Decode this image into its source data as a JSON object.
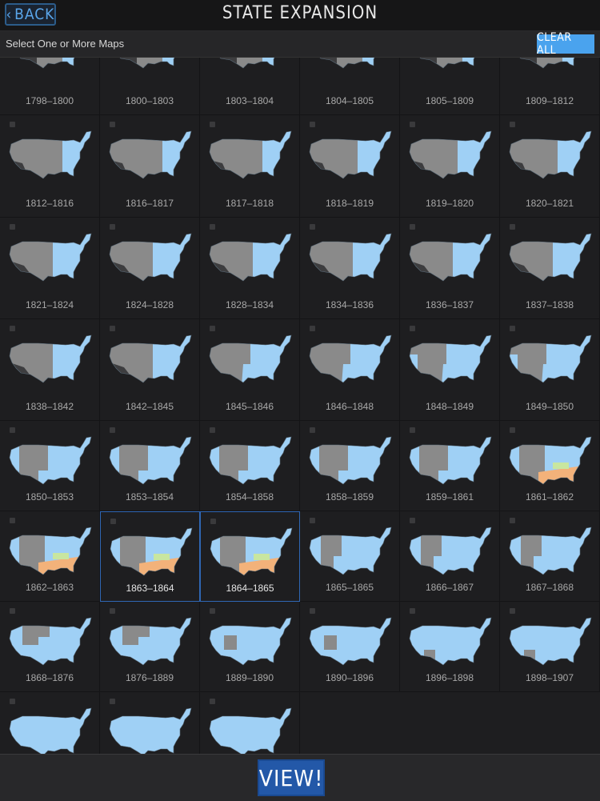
{
  "header": {
    "back_label": "BACK",
    "title": "STATE EXPANSION"
  },
  "subheader": {
    "hint": "Select One or More Maps",
    "clear_label": "CLEAR ALL"
  },
  "footer": {
    "view_label": "VIEW!"
  },
  "colors": {
    "state_blue": "#9fd0f5",
    "territory_gray": "#8a8a8a",
    "foreign_dark": "#3d3d3f",
    "confederate_orange": "#f3b27a",
    "border_green": "#c8e6a0",
    "selection_border": "#2f66b3",
    "accent": "#4aa3ee"
  },
  "maps": [
    {
      "label": "1798–1800",
      "stage": 0
    },
    {
      "label": "1800–1803",
      "stage": 0
    },
    {
      "label": "1803–1804",
      "stage": 0
    },
    {
      "label": "1804–1805",
      "stage": 0
    },
    {
      "label": "1805–1809",
      "stage": 0
    },
    {
      "label": "1809–1812",
      "stage": 0
    },
    {
      "label": "1812–1816",
      "stage": 1
    },
    {
      "label": "1816–1817",
      "stage": 1
    },
    {
      "label": "1817–1818",
      "stage": 1
    },
    {
      "label": "1818–1819",
      "stage": 2
    },
    {
      "label": "1819–1820",
      "stage": 2
    },
    {
      "label": "1820–1821",
      "stage": 2
    },
    {
      "label": "1821–1824",
      "stage": 3
    },
    {
      "label": "1824–1828",
      "stage": 3
    },
    {
      "label": "1828–1834",
      "stage": 3
    },
    {
      "label": "1834–1836",
      "stage": 3
    },
    {
      "label": "1836–1837",
      "stage": 3
    },
    {
      "label": "1837–1838",
      "stage": 3
    },
    {
      "label": "1838–1842",
      "stage": 3
    },
    {
      "label": "1842–1845",
      "stage": 3
    },
    {
      "label": "1845–1846",
      "stage": 4
    },
    {
      "label": "1846–1848",
      "stage": 4
    },
    {
      "label": "1848–1849",
      "stage": 5
    },
    {
      "label": "1849–1850",
      "stage": 5
    },
    {
      "label": "1850–1853",
      "stage": 6
    },
    {
      "label": "1853–1854",
      "stage": 6
    },
    {
      "label": "1854–1858",
      "stage": 6
    },
    {
      "label": "1858–1859",
      "stage": 6
    },
    {
      "label": "1859–1861",
      "stage": 6
    },
    {
      "label": "1861–1862",
      "stage": 7
    },
    {
      "label": "1862–1863",
      "stage": 7
    },
    {
      "label": "1863–1864",
      "stage": 7,
      "selected": true
    },
    {
      "label": "1864–1865",
      "stage": 7,
      "selected": true
    },
    {
      "label": "1865–1865",
      "stage": 8
    },
    {
      "label": "1866–1867",
      "stage": 8
    },
    {
      "label": "1867–1868",
      "stage": 8
    },
    {
      "label": "1868–1876",
      "stage": 9
    },
    {
      "label": "1876–1889",
      "stage": 9
    },
    {
      "label": "1889–1890",
      "stage": 10
    },
    {
      "label": "1890–1896",
      "stage": 10
    },
    {
      "label": "1896–1898",
      "stage": 11
    },
    {
      "label": "1898–1907",
      "stage": 11
    },
    {
      "label": "",
      "stage": 12
    },
    {
      "label": "",
      "stage": 12
    },
    {
      "label": "",
      "stage": 12
    }
  ]
}
